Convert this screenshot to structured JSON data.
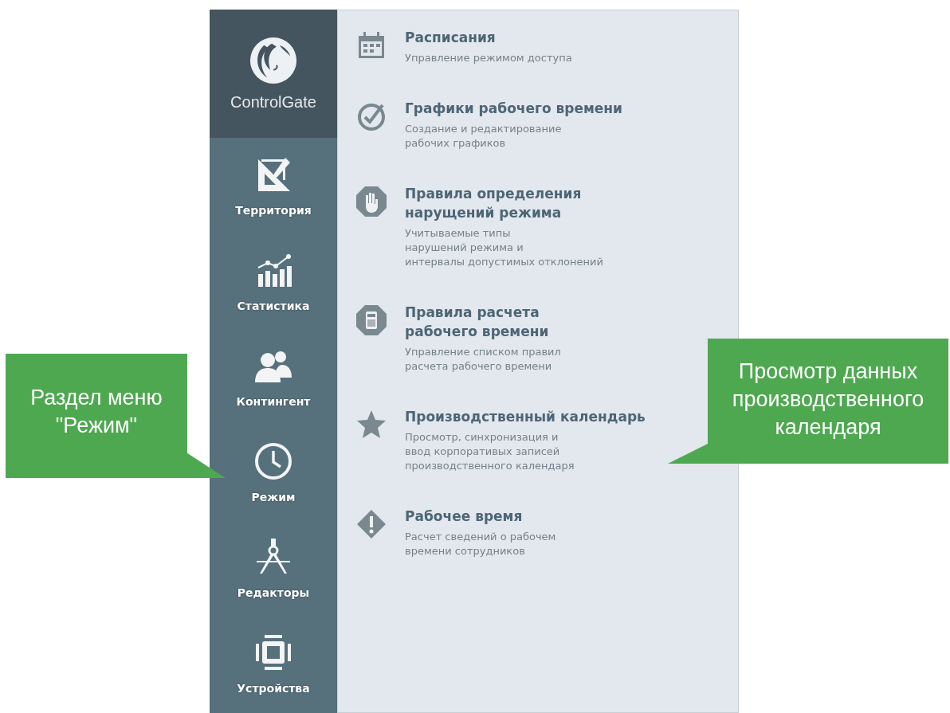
{
  "sidebar": {
    "logo_text": "ControlGate",
    "items": [
      {
        "label": "Территория"
      },
      {
        "label": "Статистика"
      },
      {
        "label": "Контингент"
      },
      {
        "label": "Режим"
      },
      {
        "label": "Редакторы"
      },
      {
        "label": "Устройства"
      }
    ]
  },
  "menu": {
    "items": [
      {
        "title": "Расписания",
        "description": "Управление режимом доступа"
      },
      {
        "title": "Графики рабочего времени",
        "description": "Создание и редактирование\nрабочих графиков"
      },
      {
        "title": "Правила определения\nнарущений режима",
        "description": "Учитываемые типы\nнарушений режима и\nинтервалы допустимых отклонений"
      },
      {
        "title": "Правила расчета\nрабочего времени",
        "description": "Управление списком правил\nрасчета рабочего времени"
      },
      {
        "title": "Производственный календарь",
        "description": "Просмотр, синхронизация и\nввод корпоративых записей\nпроизводственного календаря"
      },
      {
        "title": "Рабочее время",
        "description": "Расчет сведений о рабочем\nвремени сотрудников"
      }
    ]
  },
  "callouts": [
    {
      "text": "Раздел меню\n\"Режим\""
    },
    {
      "text": "Просмотр данных\nпроизводственного\nкалендаря"
    }
  ]
}
